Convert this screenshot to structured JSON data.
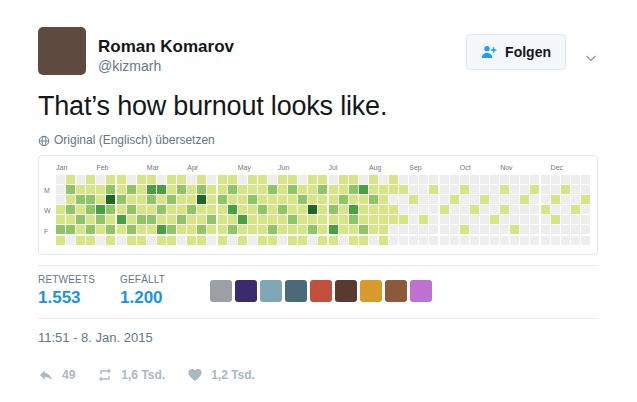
{
  "tweet": {
    "author": {
      "name": "Roman Komarov",
      "handle": "@kizmarh",
      "avatar_color": "#5e4a3f"
    },
    "follow_button": "Folgen",
    "text": "That’s how burnout looks like.",
    "translate": "Original (Englisch) übersetzen",
    "graph": {
      "months": [
        "Jan",
        "Feb",
        "Mar",
        "Apr",
        "May",
        "Jun",
        "Jul",
        "Aug",
        "Sep",
        "Oct",
        "Nov",
        "Dec"
      ],
      "days": [
        "",
        "M",
        "",
        "W",
        "",
        "F",
        ""
      ],
      "weeks": [
        [
          0,
          0,
          0,
          1,
          1,
          2,
          1
        ],
        [
          1,
          2,
          1,
          2,
          1,
          2,
          0
        ],
        [
          0,
          1,
          2,
          1,
          2,
          1,
          1
        ],
        [
          1,
          1,
          2,
          2,
          1,
          2,
          1
        ],
        [
          0,
          1,
          1,
          3,
          2,
          1,
          0
        ],
        [
          1,
          2,
          4,
          2,
          1,
          2,
          1
        ],
        [
          1,
          1,
          2,
          1,
          3,
          1,
          0
        ],
        [
          0,
          2,
          1,
          2,
          1,
          2,
          1
        ],
        [
          1,
          1,
          1,
          1,
          2,
          1,
          1
        ],
        [
          1,
          3,
          2,
          1,
          2,
          1,
          0
        ],
        [
          0,
          3,
          1,
          2,
          1,
          3,
          1
        ],
        [
          1,
          1,
          2,
          1,
          1,
          2,
          1
        ],
        [
          1,
          2,
          1,
          1,
          2,
          1,
          0
        ],
        [
          0,
          1,
          1,
          2,
          1,
          1,
          1
        ],
        [
          1,
          2,
          4,
          1,
          1,
          2,
          1
        ],
        [
          0,
          1,
          1,
          1,
          2,
          1,
          0
        ],
        [
          1,
          1,
          2,
          1,
          1,
          1,
          1
        ],
        [
          1,
          2,
          1,
          3,
          1,
          2,
          0
        ],
        [
          0,
          1,
          1,
          1,
          3,
          1,
          1
        ],
        [
          1,
          1,
          2,
          1,
          1,
          1,
          0
        ],
        [
          1,
          1,
          1,
          2,
          1,
          1,
          1
        ],
        [
          0,
          2,
          1,
          1,
          1,
          2,
          1
        ],
        [
          1,
          1,
          1,
          2,
          1,
          1,
          0
        ],
        [
          1,
          2,
          1,
          1,
          2,
          1,
          1
        ],
        [
          0,
          1,
          2,
          1,
          1,
          1,
          1
        ],
        [
          1,
          1,
          1,
          4,
          1,
          2,
          0
        ],
        [
          1,
          2,
          1,
          1,
          1,
          1,
          1
        ],
        [
          0,
          1,
          1,
          2,
          1,
          3,
          1
        ],
        [
          1,
          1,
          2,
          1,
          1,
          1,
          0
        ],
        [
          1,
          2,
          1,
          3,
          2,
          1,
          1
        ],
        [
          0,
          3,
          1,
          1,
          1,
          2,
          1
        ],
        [
          1,
          1,
          2,
          1,
          1,
          1,
          0
        ],
        [
          0,
          1,
          1,
          1,
          1,
          1,
          1
        ],
        [
          1,
          1,
          0,
          1,
          1,
          0,
          0
        ],
        [
          0,
          1,
          0,
          0,
          1,
          0,
          0
        ],
        [
          0,
          0,
          1,
          0,
          0,
          0,
          0
        ],
        [
          0,
          0,
          0,
          0,
          1,
          0,
          0
        ],
        [
          0,
          1,
          0,
          0,
          0,
          0,
          0
        ],
        [
          0,
          0,
          0,
          1,
          0,
          0,
          0
        ],
        [
          0,
          0,
          1,
          0,
          0,
          0,
          0
        ],
        [
          0,
          1,
          0,
          0,
          0,
          1,
          0
        ],
        [
          0,
          0,
          0,
          1,
          0,
          0,
          0
        ],
        [
          0,
          0,
          1,
          0,
          0,
          0,
          0
        ],
        [
          0,
          0,
          0,
          0,
          1,
          0,
          0
        ],
        [
          0,
          1,
          0,
          1,
          0,
          0,
          0
        ],
        [
          0,
          0,
          0,
          0,
          0,
          1,
          0
        ],
        [
          0,
          0,
          1,
          0,
          0,
          0,
          0
        ],
        [
          0,
          1,
          0,
          0,
          0,
          0,
          0
        ],
        [
          0,
          0,
          0,
          1,
          0,
          0,
          0
        ],
        [
          0,
          0,
          1,
          0,
          1,
          0,
          0
        ],
        [
          0,
          1,
          0,
          0,
          0,
          0,
          0
        ],
        [
          0,
          0,
          0,
          1,
          0,
          0,
          0
        ],
        [
          0,
          0,
          1,
          0,
          0,
          0,
          0
        ]
      ]
    },
    "stats": [
      {
        "label": "RETWEETS",
        "value": "1.553"
      },
      {
        "label": "GEFÄLLT",
        "value": "1.200"
      }
    ],
    "likers": [
      {
        "color": "#9aa0a6"
      },
      {
        "color": "#3a2a6e"
      },
      {
        "color": "#7fa7b8"
      },
      {
        "color": "#4a6a7a"
      },
      {
        "color": "#c0503a"
      },
      {
        "color": "#5a3a2e"
      },
      {
        "color": "#d89a2a"
      },
      {
        "color": "#8a5a3a"
      },
      {
        "color": "#c070d0"
      }
    ],
    "timestamp": "11:51 - 8. Jan. 2015",
    "actions": [
      {
        "kind": "reply",
        "count": "49"
      },
      {
        "kind": "retweet",
        "count": "1,6 Tsd."
      },
      {
        "kind": "like",
        "count": "1,2 Tsd."
      }
    ]
  }
}
